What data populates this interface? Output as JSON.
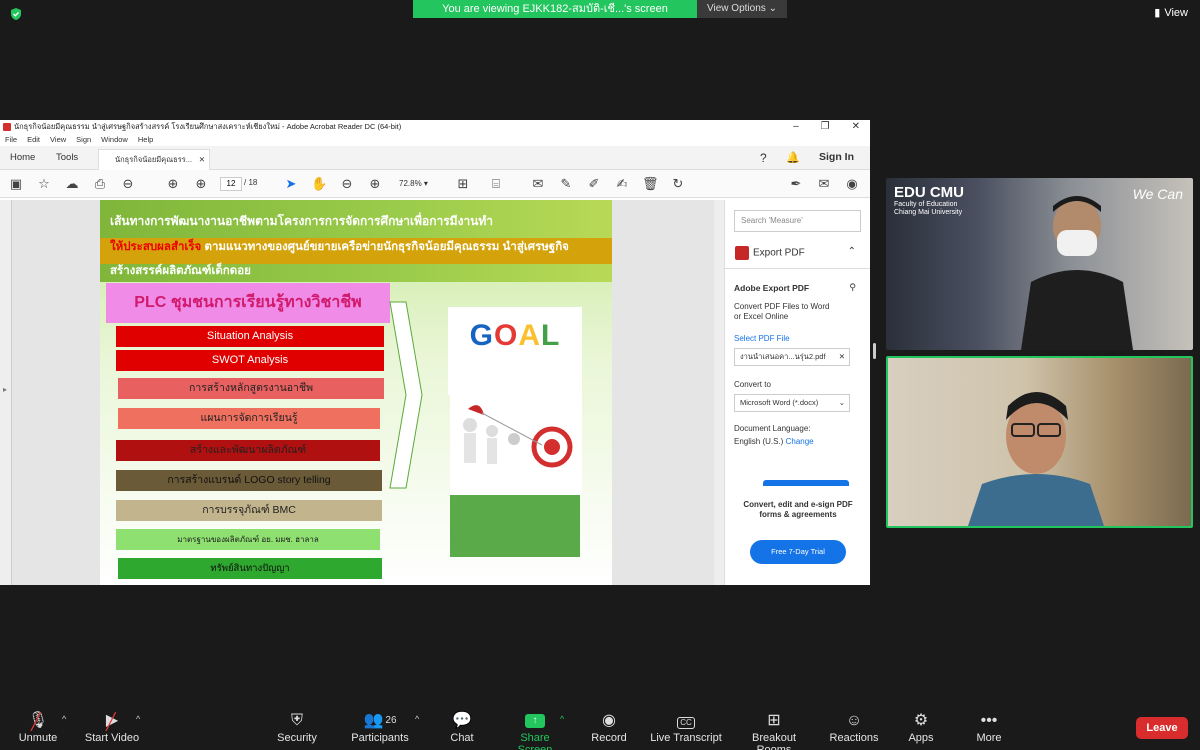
{
  "top": {
    "viewing_banner": "You are viewing EJKK182-สมบัติ-เชี...'s screen",
    "view_options": "View Options",
    "view": "View"
  },
  "acrobat": {
    "title": "นักธุรกิจน้อยมีคุณธรรม นำสู่เศรษฐกิจสร้างสรรค์ โรงเรียนศึกษาสงเคราะห์เชียงใหม่ - Adobe Acrobat Reader DC (64-bit)",
    "menu": [
      "File",
      "Edit",
      "View",
      "Sign",
      "Window",
      "Help"
    ],
    "tabs": {
      "home": "Home",
      "tools": "Tools",
      "doc": "นักธุรกิจน้อยมีคุณธรร..."
    },
    "sign_in": "Sign In",
    "page_current": "12",
    "page_total": "/ 18",
    "zoom": "72.8%"
  },
  "slide": {
    "line1": "เส้นทางการพัฒนางานอาชีพตามโครงการการจัดการศึกษาเพื่อการมีงานทำ",
    "line2_red": "ให้ประสบผลสำเร็จ",
    "line2_rest": " ตามแนวทางของศูนย์ขยายเครือข่ายนักธุรกิจน้อยมีคุณธรรม นำสู่เศรษฐกิจ",
    "line3": "สร้างสรรค์ผลิตภัณฑ์เด็กดอย",
    "plc": "PLC ชุมชนการเรียนรู้ทางวิชาชีพ",
    "steps": [
      "Situation Analysis",
      "SWOT Analysis",
      "การสร้างหลักสูตรงานอาชีพ",
      "แผนการจัดการเรียนรู้",
      "สร้างและพัฒนาผลิตภัณฑ์",
      "การสร้างแบรนด์   LOGO  story telling",
      "การบรรจุภัณฑ์ BMC",
      "มาตรฐานของผลิตภัณฑ์  อย.  มผช. ฮาลาล",
      "ทรัพย์สินทางปัญญา"
    ],
    "goal": [
      "G",
      "O",
      "A",
      "L"
    ]
  },
  "right_panel": {
    "search_placeholder": "Search 'Measure'",
    "export_pdf": "Export PDF",
    "adobe_export": "Adobe Export PDF",
    "desc1": "Convert PDF Files to Word",
    "desc2": "or Excel Online",
    "select_pdf": "Select PDF File",
    "file_name": "งานนำเสนอคา...นรุ่น2.pdf",
    "convert_to": "Convert to",
    "convert_value": "Microsoft Word (*.docx)",
    "doc_lang": "Document Language:",
    "lang_value": "English (U.S.)",
    "change": "Change",
    "promo1": "Convert, edit and e-sign PDF",
    "promo2": "forms & agreements",
    "trial": "Free 7-Day Trial"
  },
  "videos": {
    "edu_title": "EDU CMU",
    "edu_sub1": "Faculty of Education",
    "edu_sub2": "Chiang Mai University",
    "wecan": "We Can"
  },
  "bottombar": {
    "unmute": "Unmute",
    "start_video": "Start Video",
    "security": "Security",
    "participants": "Participants",
    "participants_count": "26",
    "chat": "Chat",
    "share_screen": "Share Screen",
    "record": "Record",
    "live_transcript": "Live Transcript",
    "breakout": "Breakout Rooms",
    "reactions": "Reactions",
    "apps": "Apps",
    "more": "More",
    "leave": "Leave",
    "cc": "CC"
  }
}
